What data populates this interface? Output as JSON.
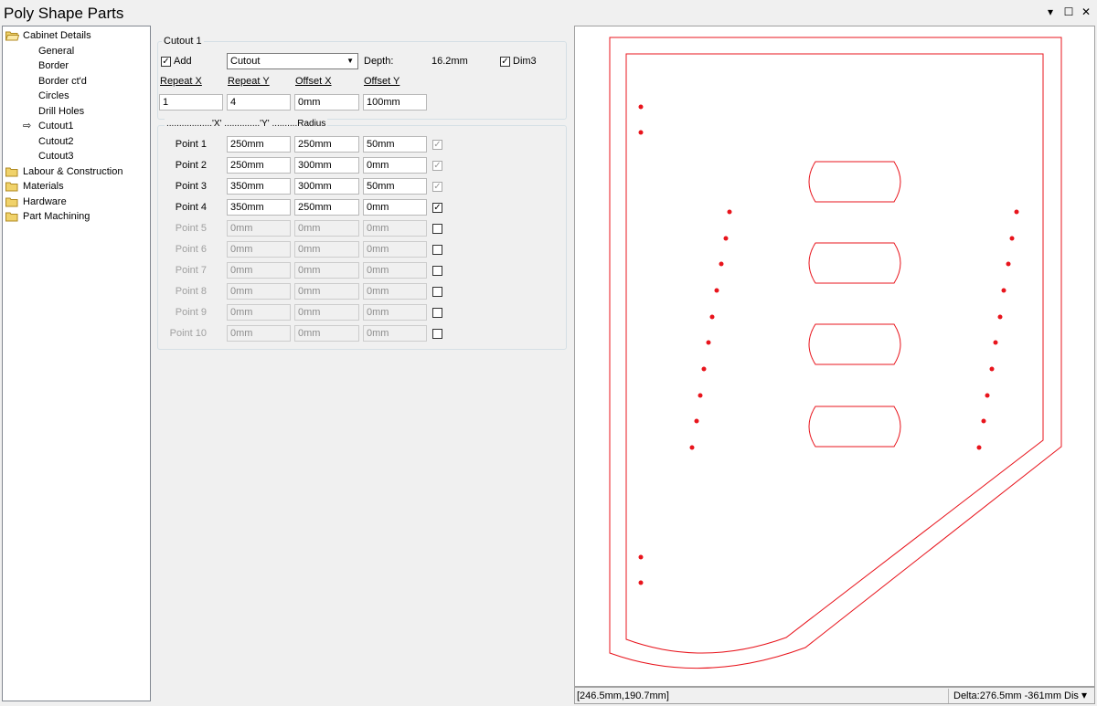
{
  "window": {
    "title": "Poly Shape Parts",
    "controls": [
      "▾",
      "☐",
      "✕"
    ]
  },
  "tree": {
    "items": [
      {
        "label": "Cabinet Details",
        "level": 0,
        "folder": true,
        "open": true
      },
      {
        "label": "General",
        "level": 1
      },
      {
        "label": "Border",
        "level": 1
      },
      {
        "label": "Border ct'd",
        "level": 1
      },
      {
        "label": "Circles",
        "level": 1
      },
      {
        "label": "Drill Holes",
        "level": 1
      },
      {
        "label": "Cutout1",
        "level": 1,
        "selected": true
      },
      {
        "label": "Cutout2",
        "level": 1
      },
      {
        "label": "Cutout3",
        "level": 1
      },
      {
        "label": "Labour & Construction",
        "level": 0,
        "folder": true
      },
      {
        "label": "Materials",
        "level": 0,
        "folder": true
      },
      {
        "label": "Hardware",
        "level": 0,
        "folder": true
      },
      {
        "label": "Part Machining",
        "level": 0,
        "folder": true
      }
    ],
    "selected_marker": "⇨"
  },
  "cutout": {
    "group_title": "Cutout 1",
    "add_label": "Add",
    "add_checked": true,
    "type_value": "Cutout",
    "depth_label": "Depth:",
    "depth_value": "16.2mm",
    "dim3_label": "Dim3",
    "dim3_checked": true,
    "headers": {
      "repeat_x": "Repeat X",
      "repeat_y": "Repeat Y",
      "offset_x": "Offset X",
      "offset_y": "Offset Y"
    },
    "values": {
      "repeat_x": "1",
      "repeat_y": "4",
      "offset_x": "0mm",
      "offset_y": "100mm"
    }
  },
  "points": {
    "group_title": "..................'X' ..............'Y' ..........Radius",
    "rows": [
      {
        "label": "Point 1",
        "x": "250mm",
        "y": "250mm",
        "r": "50mm",
        "checked": true,
        "enabled": true,
        "check_grey": true
      },
      {
        "label": "Point 2",
        "x": "250mm",
        "y": "300mm",
        "r": "0mm",
        "checked": true,
        "enabled": true,
        "check_grey": true
      },
      {
        "label": "Point 3",
        "x": "350mm",
        "y": "300mm",
        "r": "50mm",
        "checked": true,
        "enabled": true,
        "check_grey": true
      },
      {
        "label": "Point 4",
        "x": "350mm",
        "y": "250mm",
        "r": "0mm",
        "checked": true,
        "enabled": true,
        "check_grey": false
      },
      {
        "label": "Point 5",
        "x": "0mm",
        "y": "0mm",
        "r": "0mm",
        "checked": false,
        "enabled": false
      },
      {
        "label": "Point 6",
        "x": "0mm",
        "y": "0mm",
        "r": "0mm",
        "checked": false,
        "enabled": false
      },
      {
        "label": "Point 7",
        "x": "0mm",
        "y": "0mm",
        "r": "0mm",
        "checked": false,
        "enabled": false
      },
      {
        "label": "Point 8",
        "x": "0mm",
        "y": "0mm",
        "r": "0mm",
        "checked": false,
        "enabled": false
      },
      {
        "label": "Point 9",
        "x": "0mm",
        "y": "0mm",
        "r": "0mm",
        "checked": false,
        "enabled": false
      },
      {
        "label": "Point 10",
        "x": "0mm",
        "y": "0mm",
        "r": "0mm",
        "checked": false,
        "enabled": false
      }
    ]
  },
  "preview": {
    "line_color": "#e8141c",
    "hole_color": "#e8141c"
  },
  "status": {
    "coords": "[246.5mm,190.7mm]",
    "delta": "Delta:276.5mm -361mm Dis",
    "dropdown": "▾"
  }
}
